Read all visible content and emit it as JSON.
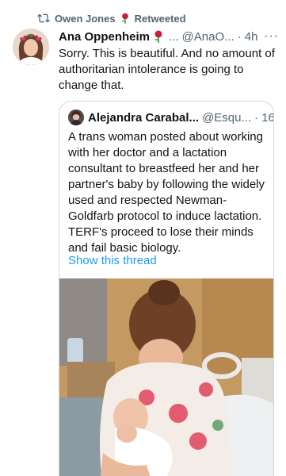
{
  "retweet": {
    "user": "Owen Jones",
    "label": "Retweeted"
  },
  "tweet": {
    "name": "Ana Oppenheim",
    "handle": "@AnaO...",
    "time": "· 4h",
    "text": "Sorry. This is beautiful. And no amount of authoritarian intolerance is going to change that."
  },
  "quote": {
    "name": "Alejandra Carabal...",
    "handle": "@Esqu...",
    "time": "· 16h",
    "text": "A trans woman posted about working with her doctor and a lactation consultant to breastfeed her and her partner's baby by following the widely used and respected Newman-Goldfarb protocol to induce lactation. TERF's proceed to lose their minds and fail basic biology.",
    "show_thread": "Show this thread"
  },
  "colors": {
    "link": "#1d9bf0",
    "secondary_text": "#536471",
    "border": "#cfd9de"
  }
}
